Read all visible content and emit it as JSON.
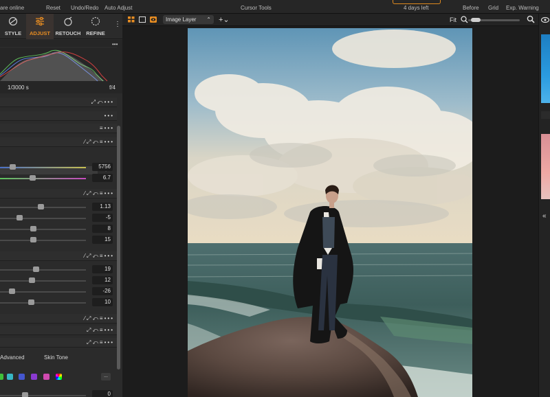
{
  "topbar": {
    "share_label": "are online",
    "reset_label": "Reset",
    "undo_label": "Undo/Redo",
    "auto_adjust_label": "Auto Adjust",
    "cursor_tools_label": "Cursor Tools",
    "trial_label": "4 days left",
    "before_label": "Before",
    "grid_label": "Grid",
    "exp_warning_label": "Exp. Warning"
  },
  "tabs": [
    {
      "label": "STYLE",
      "icon": "style-icon",
      "active": false
    },
    {
      "label": "ADJUST",
      "icon": "sliders-icon",
      "active": true
    },
    {
      "label": "RETOUCH",
      "icon": "retouch-icon",
      "active": false
    },
    {
      "label": "REFINE",
      "icon": "refine-icon",
      "active": false
    }
  ],
  "histogram": {
    "shutter": "1/3000 s",
    "aperture": "f/4"
  },
  "white_balance": {
    "kelvin": "5756",
    "tint": "6.7",
    "kelvin_level": 0.12,
    "tint_level": 0.37
  },
  "exposure": {
    "values": [
      "1.13",
      "-5",
      "8",
      "15"
    ],
    "levels": [
      0.47,
      0.21,
      0.38,
      0.38
    ]
  },
  "hdr": {
    "values": [
      "19",
      "12",
      "-26",
      "10"
    ],
    "levels": [
      0.41,
      0.36,
      0.11,
      0.35
    ]
  },
  "color_editor": {
    "advanced_label": "Advanced",
    "skin_tone_label": "Skin Tone",
    "more_label": "...",
    "bottom_value": "0",
    "swatches": [
      "#3fbf3a",
      "#37b6c4",
      "#4456cf",
      "#8a3ad0",
      "#d04ab0",
      "#rainbow"
    ]
  },
  "viewer": {
    "layer_select": "Image Layer",
    "fit_label": "Fit",
    "zoom_level": 0.05
  },
  "colors": {
    "accent": "#e88d22"
  }
}
